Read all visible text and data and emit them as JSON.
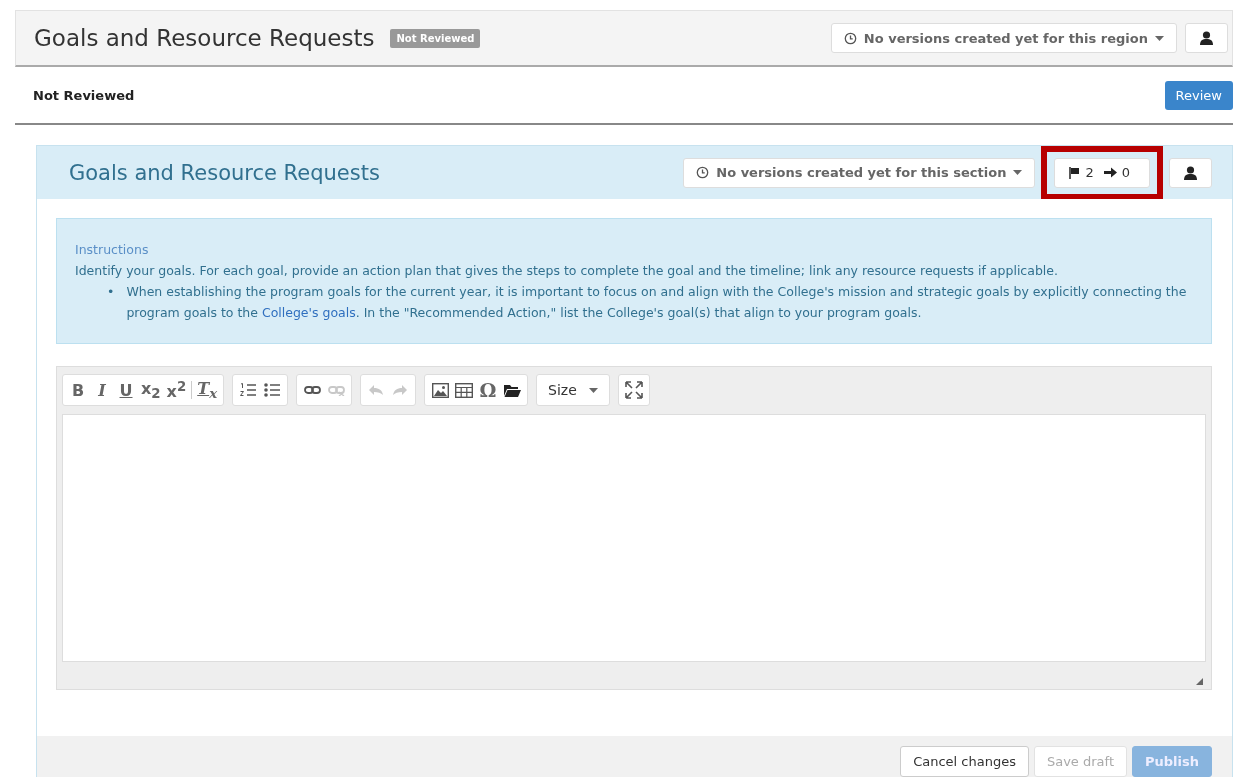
{
  "header": {
    "title": "Goals and Resource Requests",
    "badge": "Not Reviewed",
    "versions": "No versions created yet for this region"
  },
  "status": {
    "label": "Not Reviewed",
    "button": "Review"
  },
  "section": {
    "title": "Goals and Resource Requests",
    "versions": "No versions created yet for this section",
    "flags": "2",
    "arrows": "0",
    "highlighted": true
  },
  "instructions": {
    "heading": "Instructions",
    "text": "Identify your goals. For each goal, provide an action plan that gives the steps to complete the goal and the timeline; link any resource requests if applicable.",
    "bullet": "•",
    "bullet_before": "When establishing the program goals for the current year, it is important to focus on and align with the College's mission and strategic goals by explicitly connecting the program goals to the ",
    "link": "College's goals",
    "bullet_after": ". In the \"Recommended Action,\" list the College's goal(s) that align to your program goals."
  },
  "toolbar": [
    {
      "items": [
        {
          "label": "B",
          "disabled": false
        },
        {
          "label": "I",
          "disabled": false
        },
        {
          "label": "U",
          "disabled": false
        },
        {
          "label": "x$_{2}$",
          "disabled": false
        },
        {
          "label": "x$^{2}$",
          "disabled": false
        },
        {
          "label": "T$_{x}$",
          "disabled": false
        }
      ]
    },
    {
      "items": [
        {
          "disabled": false
        },
        {
          "disabled": false
        }
      ]
    },
    {
      "items": [
        {
          "disabled": false
        },
        {
          "disabled": true
        }
      ]
    },
    {
      "items": [
        {
          "disabled": true
        },
        {
          "disabled": true
        }
      ]
    },
    {
      "items": [
        {
          "disabled": false
        },
        {
          "disabled": false
        },
        {
          "label": "Ω",
          "disabled": false
        },
        {
          "disabled": false
        }
      ]
    },
    {
      "items": [
        {
          "label": "Size",
          "disabled": false
        }
      ]
    },
    {
      "items": [
        {
          "disabled": false
        }
      ]
    }
  ],
  "footer": [
    {
      "label": "Cancel changes",
      "kind": "default",
      "disabled": false
    },
    {
      "label": "Save draft",
      "kind": "default",
      "disabled": true
    },
    {
      "label": "Publish",
      "kind": "primary",
      "disabled": true
    }
  ]
}
